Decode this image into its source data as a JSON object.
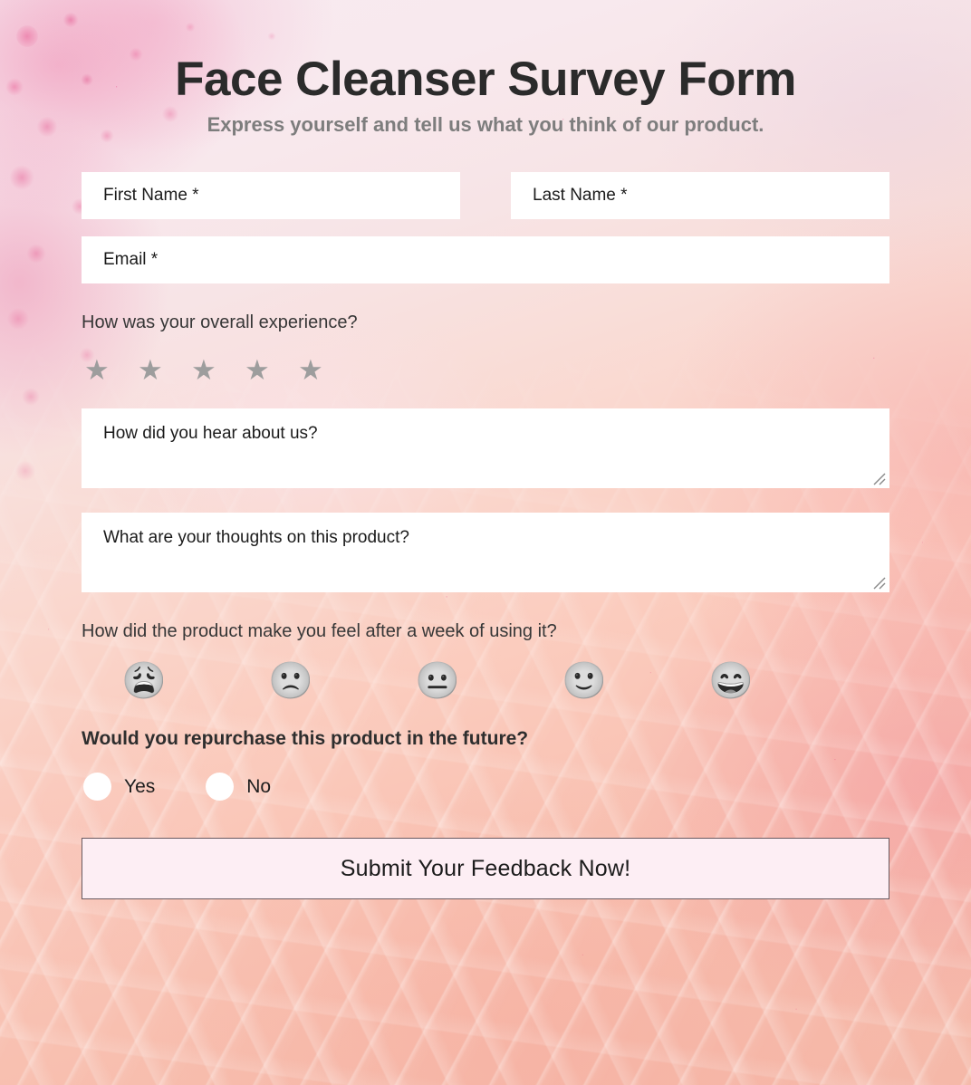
{
  "header": {
    "title": "Face Cleanser Survey Form",
    "subtitle": "Express yourself and tell us what you think of our product."
  },
  "fields": {
    "first_name": {
      "placeholder": "First Name *",
      "value": ""
    },
    "last_name": {
      "placeholder": "Last Name *",
      "value": ""
    },
    "email": {
      "placeholder": "Email *",
      "value": ""
    }
  },
  "rating": {
    "question": "How was your overall experience?",
    "max": 5,
    "selected": 0,
    "star_glyph": "★",
    "empty_color": "#9d9d9d"
  },
  "textareas": {
    "referral": {
      "placeholder": "How did you hear about us?",
      "value": ""
    },
    "thoughts": {
      "placeholder": "What are your thoughts on this product?",
      "value": ""
    }
  },
  "mood": {
    "question": "How did the product make you feel after a week of using it?",
    "options": [
      {
        "name": "weary-face",
        "glyph": "😩"
      },
      {
        "name": "frowning-face",
        "glyph": "🙁"
      },
      {
        "name": "neutral-face",
        "glyph": "😐"
      },
      {
        "name": "slightly-smiling-face",
        "glyph": "🙂"
      },
      {
        "name": "grinning-face-with-smiling-eyes",
        "glyph": "😄"
      }
    ],
    "selected": null
  },
  "repurchase": {
    "question": "Would you repurchase this product in the future?",
    "options": [
      {
        "label": "Yes",
        "value": "yes",
        "selected": false
      },
      {
        "label": "No",
        "value": "no",
        "selected": false
      }
    ]
  },
  "submit": {
    "label": "Submit Your Feedback Now!",
    "background": "#fdeef4",
    "border_color": "#6a5a60"
  },
  "theme": {
    "title_color": "#2b2b2b",
    "subtitle_color": "#7d7d7d",
    "question_color": "#373737",
    "field_background": "#ffffff"
  }
}
